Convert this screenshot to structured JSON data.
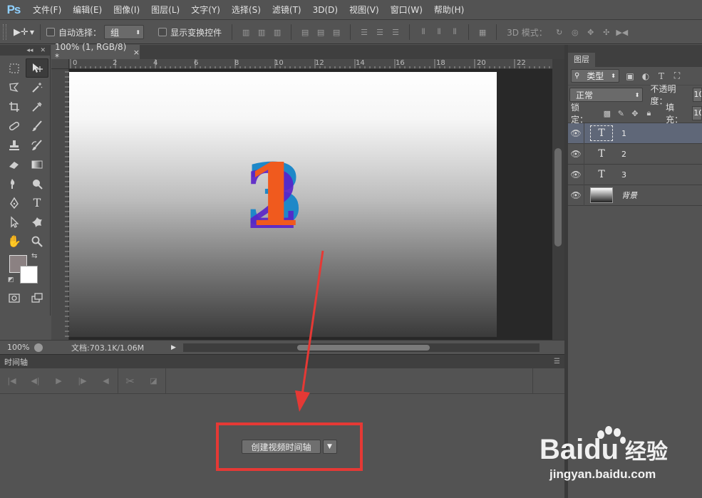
{
  "app": {
    "logo": "Ps"
  },
  "menu": [
    "文件(F)",
    "编辑(E)",
    "图像(I)",
    "图层(L)",
    "文字(Y)",
    "选择(S)",
    "滤镜(T)",
    "3D(D)",
    "视图(V)",
    "窗口(W)",
    "帮助(H)"
  ],
  "options": {
    "auto_select_label": "自动选择：",
    "auto_select_value": "组",
    "show_transform_label": "显示变换控件",
    "threed_mode_label": "3D 模式："
  },
  "document": {
    "tab_title": "100% (1, RGB/8) *",
    "close_glyph": "×",
    "ruler_marks": [
      "0",
      "2",
      "4",
      "6",
      "8",
      "10",
      "12",
      "14",
      "16",
      "18",
      "20",
      "22"
    ]
  },
  "status": {
    "zoom": "100%",
    "doc_size": "文档:703.1K/1.06M"
  },
  "timeline": {
    "tab": "时间轴",
    "create_button": "创建视频时间轴"
  },
  "layers_panel": {
    "tab": "图层",
    "filter_label": "类型",
    "blend_mode": "正常",
    "opacity_label": "不透明度：",
    "opacity_value": "10",
    "lock_label": "锁定：",
    "fill_label": "填充：",
    "fill_value": "10",
    "layers": [
      {
        "name": "1",
        "kind": "text",
        "selected": true
      },
      {
        "name": "2",
        "kind": "text",
        "selected": false
      },
      {
        "name": "3",
        "kind": "text",
        "selected": false
      },
      {
        "name": "背景",
        "kind": "background",
        "selected": false
      }
    ]
  },
  "canvas": {
    "glyph_back": "3",
    "glyph_mid": "2",
    "glyph_front": "1"
  },
  "colors": {
    "accent_red": "#e53935",
    "glyph_blue": "#1e88c8",
    "glyph_purple": "#5a22c8",
    "glyph_orange": "#f05a1e",
    "foreground_swatch": "#8b8182",
    "background_swatch": "#ffffff"
  },
  "watermark": {
    "brand": "Baidu",
    "brand_cn": "经验",
    "url": "jingyan.baidu.com"
  }
}
